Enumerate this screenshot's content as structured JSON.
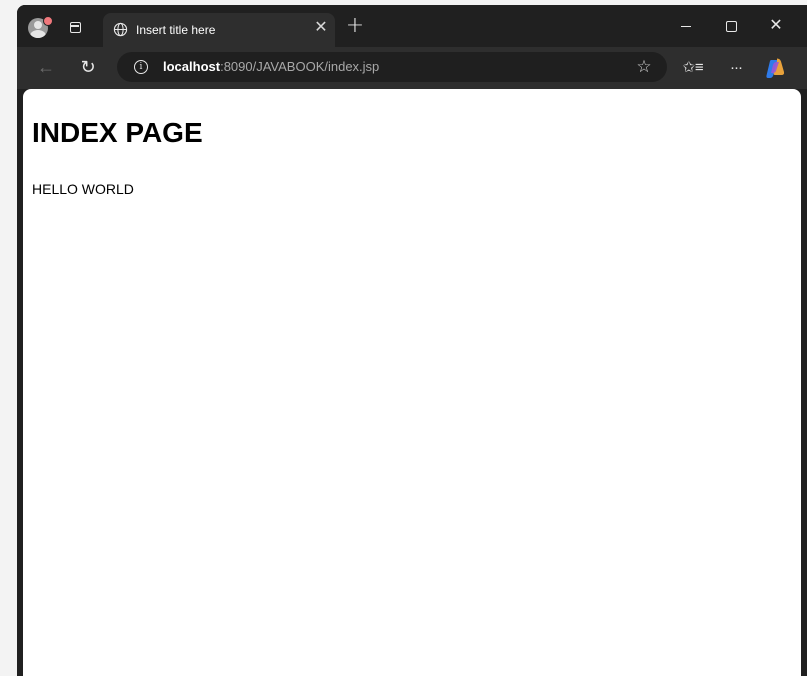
{
  "browser": {
    "tab": {
      "title": "Insert title here",
      "close_glyph": "✕"
    },
    "new_tab_glyph": "+",
    "address": {
      "host": "localhost",
      "rest": ":8090/JAVABOOK/index.jsp"
    },
    "icons": {
      "profile": "profile-avatar-icon",
      "workspaces": "workspaces-icon",
      "globe": "globe-icon",
      "back": "back-arrow-icon",
      "reload": "reload-icon",
      "info": "info-icon",
      "favorite": "star-icon",
      "favorites": "favorites-icon",
      "more": "more-icon",
      "copilot": "copilot-icon"
    },
    "glyphs": {
      "back": "←",
      "reload": "↻",
      "info": "i",
      "star": "☆",
      "favorites": "✩≡",
      "more": "···",
      "close_window": "✕"
    },
    "colors": {
      "titlebar": "#202020",
      "toolbar": "#2e2e2e",
      "omnibox": "#1f1f1f",
      "profile_badge": "#f0787c",
      "page_background": "#ffffff"
    }
  },
  "page": {
    "heading": "INDEX PAGE",
    "text": "HELLO WORLD"
  }
}
